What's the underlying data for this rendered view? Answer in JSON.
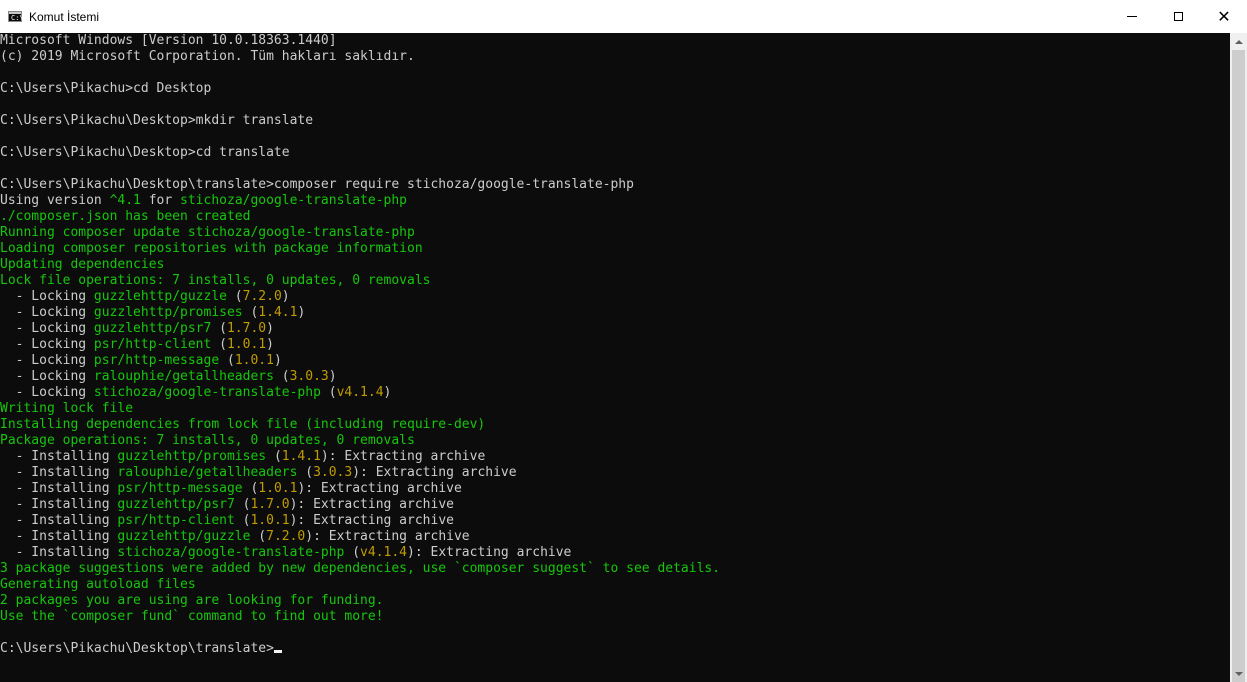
{
  "window": {
    "title": "Komut İstemi",
    "icon": "console-app-icon",
    "icon_glyph": "C:\\",
    "controls": {
      "minimize": "minimize-icon",
      "maximize": "maximize-icon",
      "close": "✕"
    }
  },
  "colors": {
    "background": "#0c0c0c",
    "text": "#cccccc",
    "green": "#16c60c",
    "yellow": "#c19c00"
  },
  "console": {
    "lines": [
      [
        {
          "t": "Microsoft Windows [Version 10.0.18363.1440]",
          "c": "w"
        }
      ],
      [
        {
          "t": "(c) 2019 Microsoft Corporation. Tüm hakları saklıdır.",
          "c": "w"
        }
      ],
      [],
      [
        {
          "t": "C:\\Users\\Pikachu>cd Desktop",
          "c": "w"
        }
      ],
      [],
      [
        {
          "t": "C:\\Users\\Pikachu\\Desktop>mkdir translate",
          "c": "w"
        }
      ],
      [],
      [
        {
          "t": "C:\\Users\\Pikachu\\Desktop>cd translate",
          "c": "w"
        }
      ],
      [],
      [
        {
          "t": "C:\\Users\\Pikachu\\Desktop\\translate>composer require stichoza/google-translate-php",
          "c": "w"
        }
      ],
      [
        {
          "t": "Using version ",
          "c": "w"
        },
        {
          "t": "^4.1",
          "c": "g"
        },
        {
          "t": " for ",
          "c": "w"
        },
        {
          "t": "stichoza/google-translate-php",
          "c": "g"
        }
      ],
      [
        {
          "t": "./composer.json has been created",
          "c": "g"
        }
      ],
      [
        {
          "t": "Running composer update stichoza/google-translate-php",
          "c": "g"
        }
      ],
      [
        {
          "t": "Loading composer repositories with package information",
          "c": "g"
        }
      ],
      [
        {
          "t": "Updating dependencies",
          "c": "g"
        }
      ],
      [
        {
          "t": "Lock file operations: 7 installs, 0 updates, 0 removals",
          "c": "g"
        }
      ],
      [
        {
          "t": "  - Locking ",
          "c": "w"
        },
        {
          "t": "guzzlehttp/guzzle",
          "c": "g"
        },
        {
          "t": " (",
          "c": "w"
        },
        {
          "t": "7.2.0",
          "c": "y"
        },
        {
          "t": ")",
          "c": "w"
        }
      ],
      [
        {
          "t": "  - Locking ",
          "c": "w"
        },
        {
          "t": "guzzlehttp/promises",
          "c": "g"
        },
        {
          "t": " (",
          "c": "w"
        },
        {
          "t": "1.4.1",
          "c": "y"
        },
        {
          "t": ")",
          "c": "w"
        }
      ],
      [
        {
          "t": "  - Locking ",
          "c": "w"
        },
        {
          "t": "guzzlehttp/psr7",
          "c": "g"
        },
        {
          "t": " (",
          "c": "w"
        },
        {
          "t": "1.7.0",
          "c": "y"
        },
        {
          "t": ")",
          "c": "w"
        }
      ],
      [
        {
          "t": "  - Locking ",
          "c": "w"
        },
        {
          "t": "psr/http-client",
          "c": "g"
        },
        {
          "t": " (",
          "c": "w"
        },
        {
          "t": "1.0.1",
          "c": "y"
        },
        {
          "t": ")",
          "c": "w"
        }
      ],
      [
        {
          "t": "  - Locking ",
          "c": "w"
        },
        {
          "t": "psr/http-message",
          "c": "g"
        },
        {
          "t": " (",
          "c": "w"
        },
        {
          "t": "1.0.1",
          "c": "y"
        },
        {
          "t": ")",
          "c": "w"
        }
      ],
      [
        {
          "t": "  - Locking ",
          "c": "w"
        },
        {
          "t": "ralouphie/getallheaders",
          "c": "g"
        },
        {
          "t": " (",
          "c": "w"
        },
        {
          "t": "3.0.3",
          "c": "y"
        },
        {
          "t": ")",
          "c": "w"
        }
      ],
      [
        {
          "t": "  - Locking ",
          "c": "w"
        },
        {
          "t": "stichoza/google-translate-php",
          "c": "g"
        },
        {
          "t": " (",
          "c": "w"
        },
        {
          "t": "v4.1.4",
          "c": "y"
        },
        {
          "t": ")",
          "c": "w"
        }
      ],
      [
        {
          "t": "Writing lock file",
          "c": "g"
        }
      ],
      [
        {
          "t": "Installing dependencies from lock file (including require-dev)",
          "c": "g"
        }
      ],
      [
        {
          "t": "Package operations: 7 installs, 0 updates, 0 removals",
          "c": "g"
        }
      ],
      [
        {
          "t": "  - Installing ",
          "c": "w"
        },
        {
          "t": "guzzlehttp/promises",
          "c": "g"
        },
        {
          "t": " (",
          "c": "w"
        },
        {
          "t": "1.4.1",
          "c": "y"
        },
        {
          "t": "): Extracting archive",
          "c": "w"
        }
      ],
      [
        {
          "t": "  - Installing ",
          "c": "w"
        },
        {
          "t": "ralouphie/getallheaders",
          "c": "g"
        },
        {
          "t": " (",
          "c": "w"
        },
        {
          "t": "3.0.3",
          "c": "y"
        },
        {
          "t": "): Extracting archive",
          "c": "w"
        }
      ],
      [
        {
          "t": "  - Installing ",
          "c": "w"
        },
        {
          "t": "psr/http-message",
          "c": "g"
        },
        {
          "t": " (",
          "c": "w"
        },
        {
          "t": "1.0.1",
          "c": "y"
        },
        {
          "t": "): Extracting archive",
          "c": "w"
        }
      ],
      [
        {
          "t": "  - Installing ",
          "c": "w"
        },
        {
          "t": "guzzlehttp/psr7",
          "c": "g"
        },
        {
          "t": " (",
          "c": "w"
        },
        {
          "t": "1.7.0",
          "c": "y"
        },
        {
          "t": "): Extracting archive",
          "c": "w"
        }
      ],
      [
        {
          "t": "  - Installing ",
          "c": "w"
        },
        {
          "t": "psr/http-client",
          "c": "g"
        },
        {
          "t": " (",
          "c": "w"
        },
        {
          "t": "1.0.1",
          "c": "y"
        },
        {
          "t": "): Extracting archive",
          "c": "w"
        }
      ],
      [
        {
          "t": "  - Installing ",
          "c": "w"
        },
        {
          "t": "guzzlehttp/guzzle",
          "c": "g"
        },
        {
          "t": " (",
          "c": "w"
        },
        {
          "t": "7.2.0",
          "c": "y"
        },
        {
          "t": "): Extracting archive",
          "c": "w"
        }
      ],
      [
        {
          "t": "  - Installing ",
          "c": "w"
        },
        {
          "t": "stichoza/google-translate-php",
          "c": "g"
        },
        {
          "t": " (",
          "c": "w"
        },
        {
          "t": "v4.1.4",
          "c": "y"
        },
        {
          "t": "): Extracting archive",
          "c": "w"
        }
      ],
      [
        {
          "t": "3 package suggestions were added by new dependencies, use `composer suggest` to see details.",
          "c": "g"
        }
      ],
      [
        {
          "t": "Generating autoload files",
          "c": "g"
        }
      ],
      [
        {
          "t": "2 packages you are using are looking for funding.",
          "c": "g"
        }
      ],
      [
        {
          "t": "Use the `composer fund` command to find out more!",
          "c": "g"
        }
      ],
      [],
      [
        {
          "t": "C:\\Users\\Pikachu\\Desktop\\translate>",
          "c": "w"
        },
        {
          "cursor": true
        }
      ]
    ]
  }
}
